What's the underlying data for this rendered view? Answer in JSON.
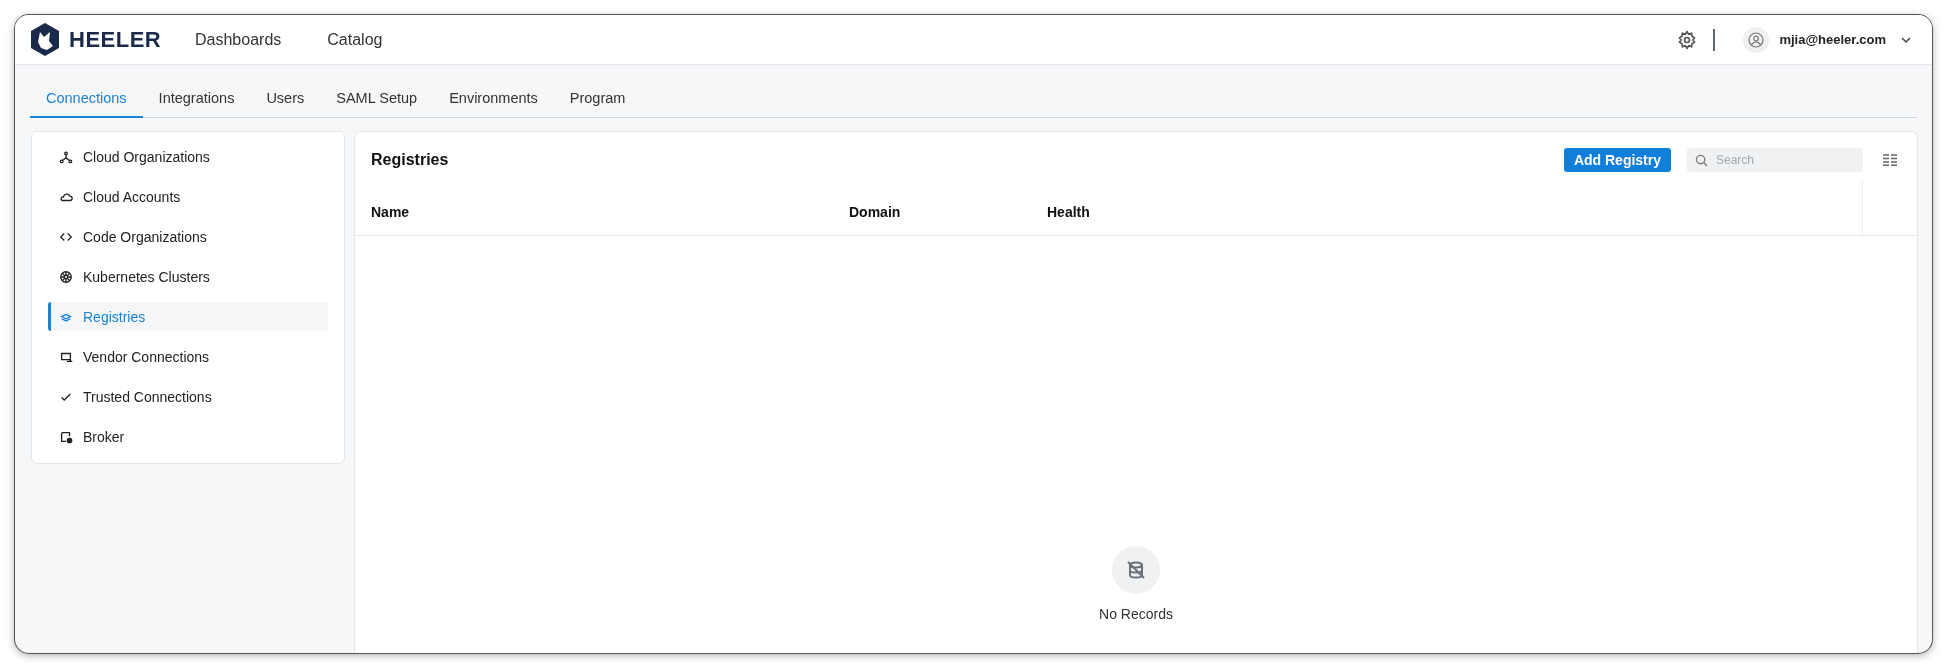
{
  "header": {
    "brand": "HEELER",
    "nav": [
      {
        "label": "Dashboards"
      },
      {
        "label": "Catalog"
      }
    ],
    "user": "mjia@heeler.com"
  },
  "tabs": [
    {
      "label": "Connections",
      "selected": true
    },
    {
      "label": "Integrations",
      "selected": false
    },
    {
      "label": "Users",
      "selected": false
    },
    {
      "label": "SAML Setup",
      "selected": false
    },
    {
      "label": "Environments",
      "selected": false
    },
    {
      "label": "Program",
      "selected": false
    }
  ],
  "sidebar": {
    "items": [
      {
        "label": "Cloud Organizations",
        "selected": false
      },
      {
        "label": "Cloud Accounts",
        "selected": false
      },
      {
        "label": "Code Organizations",
        "selected": false
      },
      {
        "label": "Kubernetes Clusters",
        "selected": false
      },
      {
        "label": "Registries",
        "selected": true
      },
      {
        "label": "Vendor Connections",
        "selected": false
      },
      {
        "label": "Trusted Connections",
        "selected": false
      },
      {
        "label": "Broker",
        "selected": false
      }
    ]
  },
  "panel": {
    "title": "Registries",
    "add_button": "Add Registry",
    "search": {
      "placeholder": "Search"
    },
    "table": {
      "columns": [
        "Name",
        "Domain",
        "Health"
      ]
    },
    "empty_message": "No Records"
  }
}
